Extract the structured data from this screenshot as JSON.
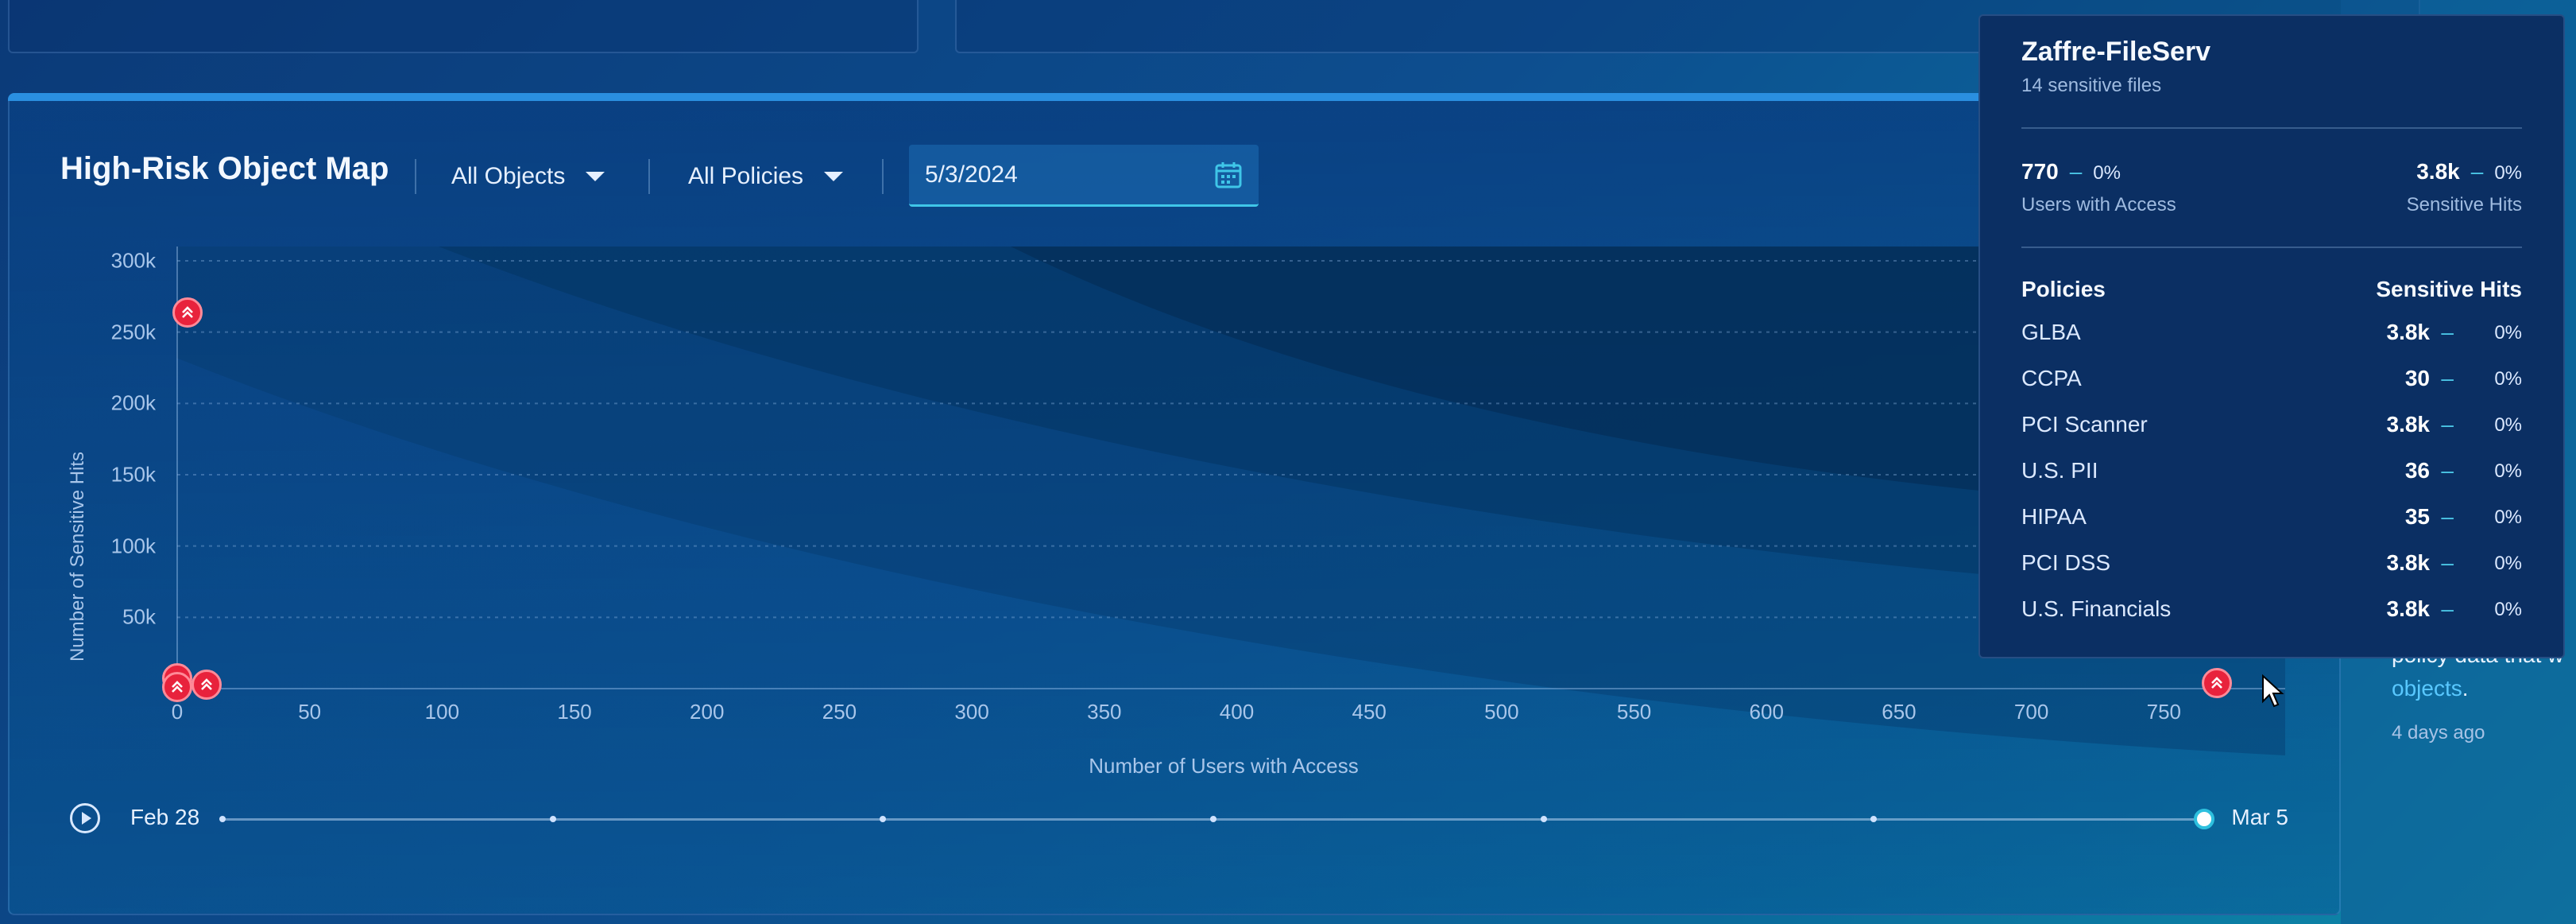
{
  "map": {
    "title": "High-Risk Object Map",
    "objects_filter": "All Objects",
    "policies_filter": "All Policies",
    "date": "5/3/2024"
  },
  "right_panel": {
    "text_line": "policy data that w",
    "link_text": "objects",
    "link_suffix": ".",
    "timestamp": "4 days ago"
  },
  "timeline": {
    "start_label": "Feb 28",
    "end_label": "Mar 5",
    "position": 1.0
  },
  "tooltip": {
    "title": "Zaffre-FileServ",
    "subtitle": "14 sensitive files",
    "users_value": "770",
    "users_pct": "0%",
    "users_label": "Users with Access",
    "hits_value": "3.8k",
    "hits_pct": "0%",
    "hits_label": "Sensitive Hits",
    "policies_header": "Policies",
    "hits_header": "Sensitive Hits",
    "dash": "–",
    "policies": [
      {
        "name": "GLBA",
        "value": "3.8k",
        "pct": "0%"
      },
      {
        "name": "CCPA",
        "value": "30",
        "pct": "0%"
      },
      {
        "name": "PCI Scanner",
        "value": "3.8k",
        "pct": "0%"
      },
      {
        "name": "U.S. PII",
        "value": "36",
        "pct": "0%"
      },
      {
        "name": "HIPAA",
        "value": "35",
        "pct": "0%"
      },
      {
        "name": "PCI DSS",
        "value": "3.8k",
        "pct": "0%"
      },
      {
        "name": "U.S. Financials",
        "value": "3.8k",
        "pct": "0%"
      }
    ]
  },
  "colors": {
    "marker": "#e8223c",
    "accent": "#3fc6e8",
    "tooltip_bg": "#0b2f63"
  },
  "chart_data": {
    "type": "scatter",
    "xlabel": "Number of Users with Access",
    "ylabel": "Number of Sensitive Hits",
    "xlim": [
      0,
      770
    ],
    "ylim": [
      0,
      300000
    ],
    "x_ticks": [
      "0",
      "50",
      "100",
      "150",
      "200",
      "250",
      "300",
      "350",
      "400",
      "450",
      "500",
      "550",
      "600",
      "650",
      "700",
      "750"
    ],
    "y_ticks": [
      "50k",
      "100k",
      "150k",
      "200k",
      "250k",
      "300k"
    ],
    "grid": true,
    "points": [
      {
        "x": 4,
        "y": 264000
      },
      {
        "x": 0,
        "y": 7000
      },
      {
        "x": 0,
        "y": 1000
      },
      {
        "x": 11,
        "y": 3000
      },
      {
        "x": 770,
        "y": 3800
      }
    ]
  }
}
